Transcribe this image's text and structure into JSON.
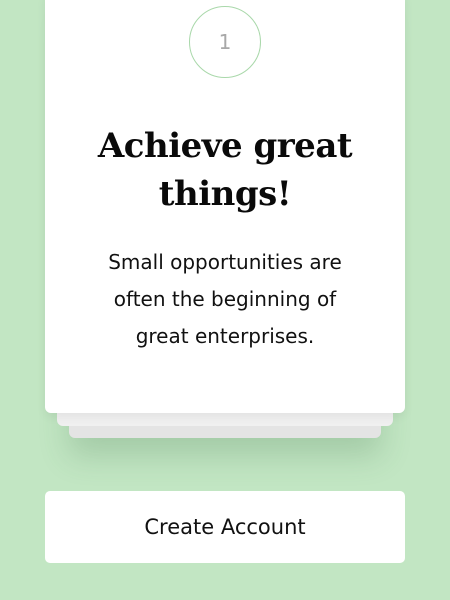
{
  "step": {
    "number": "1"
  },
  "card": {
    "title": "Achieve great things!",
    "body": "Small opportunities are often the beginning of great enterprises."
  },
  "actions": {
    "primary_label": "Create Account"
  },
  "colors": {
    "background": "#c2e6c3",
    "card": "#ffffff",
    "step_border": "#a9d8aa",
    "step_text": "#a8a8a8",
    "text": "#111111"
  }
}
